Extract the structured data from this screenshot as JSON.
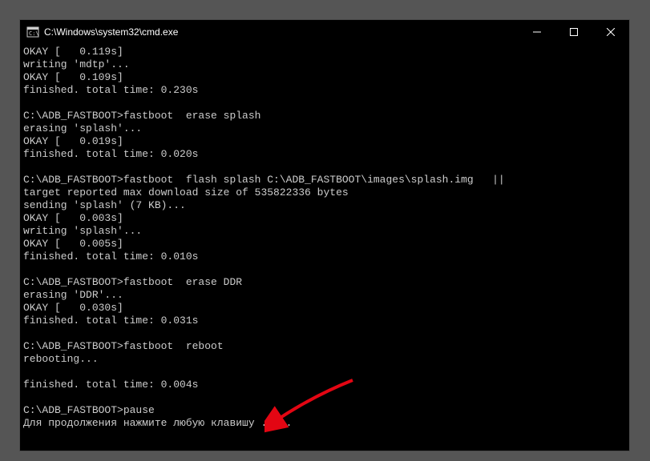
{
  "window": {
    "title": "C:\\Windows\\system32\\cmd.exe"
  },
  "terminal": {
    "lines": [
      "OKAY [   0.119s]",
      "writing 'mdtp'...",
      "OKAY [   0.109s]",
      "finished. total time: 0.230s",
      "",
      "C:\\ADB_FASTBOOT>fastboot  erase splash",
      "erasing 'splash'...",
      "OKAY [   0.019s]",
      "finished. total time: 0.020s",
      "",
      "C:\\ADB_FASTBOOT>fastboot  flash splash C:\\ADB_FASTBOOT\\images\\splash.img   ||",
      "target reported max download size of 535822336 bytes",
      "sending 'splash' (7 KB)...",
      "OKAY [   0.003s]",
      "writing 'splash'...",
      "OKAY [   0.005s]",
      "finished. total time: 0.010s",
      "",
      "C:\\ADB_FASTBOOT>fastboot  erase DDR",
      "erasing 'DDR'...",
      "OKAY [   0.030s]",
      "finished. total time: 0.031s",
      "",
      "C:\\ADB_FASTBOOT>fastboot  reboot",
      "rebooting...",
      "",
      "finished. total time: 0.004s",
      "",
      "C:\\ADB_FASTBOOT>pause",
      "Для продолжения нажмите любую клавишу . . ."
    ]
  }
}
